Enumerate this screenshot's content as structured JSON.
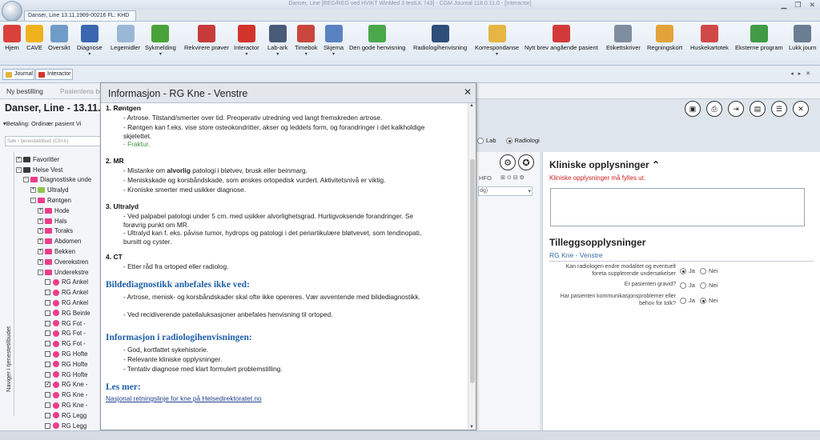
{
  "window": {
    "title": "Danser, Line [REG/REG ved HVIKT WinMed 3 testLK 743] - CGM Journal 118.0.11.0 - [Interactor]",
    "app_tab": "Danser, Line 13.11.1969-00216 FL: KHD"
  },
  "ribbon": {
    "buttons": [
      {
        "label": "Hjem",
        "icon": "home-icon",
        "color": "#d9413c"
      },
      {
        "label": "CAVE",
        "icon": "warning-icon",
        "color": "#f0b21c"
      },
      {
        "label": "Oversikt",
        "icon": "overview-icon",
        "color": "#6f9bc8"
      },
      {
        "label": "Diagnose",
        "icon": "diagnose-icon",
        "color": "#3a67b0"
      },
      {
        "label": "Legemidler",
        "icon": "pill-icon",
        "color": "#9bb7d6"
      },
      {
        "label": "Sykmelding",
        "icon": "wheelchair-icon",
        "color": "#4aa23a"
      },
      {
        "label": "Rekvirere prøver",
        "icon": "test-tube-icon",
        "color": "#c73a3a"
      },
      {
        "label": "Interactor",
        "icon": "interactor-icon",
        "color": "#d2342b"
      },
      {
        "label": "Lab-ark",
        "icon": "lab-sheet-icon",
        "color": "#4a5b7a"
      },
      {
        "label": "Timebok",
        "icon": "calendar-icon",
        "color": "#c9463c"
      },
      {
        "label": "Skjema",
        "icon": "form-icon",
        "color": "#5b82c0"
      },
      {
        "label": "Den gode henvisning",
        "icon": "referral-icon",
        "color": "#49a84a"
      },
      {
        "label": "Radiologihenvisning",
        "icon": "radiology-icon",
        "color": "#2e4f7a"
      },
      {
        "label": "Korrespondanse",
        "icon": "envelope-icon",
        "color": "#e6b543"
      },
      {
        "label": "Nytt brev angående pasient",
        "icon": "new-letter-icon",
        "color": "#d23a3a"
      },
      {
        "label": "Etikettskriver",
        "icon": "label-printer-icon",
        "color": "#7f8da0"
      },
      {
        "label": "Regningskort",
        "icon": "invoice-icon",
        "color": "#e2a33a"
      },
      {
        "label": "Huskekartotek",
        "icon": "checklist-icon",
        "color": "#d14848"
      },
      {
        "label": "Eksterne program",
        "icon": "gear-puzzle-icon",
        "color": "#3f9b45"
      },
      {
        "label": "Lukk journ",
        "icon": "close-journal-icon",
        "color": "#6a7d92"
      }
    ],
    "dropdown_marker": "▾"
  },
  "strip": {
    "tabs": [
      {
        "label": "Journal",
        "color": "#e3b53a"
      },
      {
        "label": "Interactor",
        "color": "#d2342b"
      }
    ],
    "nav_arrows": "◂ ▸ ✕"
  },
  "subtabs": {
    "new_order": "Ny bestilling",
    "patient_orders": "Pasientens be"
  },
  "patient": {
    "name": "Danser, Line - 13.11.1969"
  },
  "payment": "Betaling: Ordinær pasient Vi",
  "search": {
    "placeholder": "Søk i tjenestetilbud (Ctrl-k)"
  },
  "navigator_label": "Naviger i tjenestetilbudet",
  "tree": [
    {
      "level": 0,
      "kind": "folder",
      "toggle": "+",
      "label": "Favoritter",
      "color": "#3a3a3a"
    },
    {
      "level": 0,
      "kind": "folder",
      "toggle": "−",
      "label": "Helse Vest",
      "color": "#3a3a3a"
    },
    {
      "level": 1,
      "kind": "folder",
      "toggle": "−",
      "label": "Diagnostiske unde",
      "color": "#ec3d8b"
    },
    {
      "level": 2,
      "kind": "folder",
      "toggle": "+",
      "label": "Ultralyd",
      "color": "#8bc34a"
    },
    {
      "level": 2,
      "kind": "folder",
      "toggle": "−",
      "label": "Røntgen",
      "color": "#ec3d8b"
    },
    {
      "level": 3,
      "kind": "folder",
      "toggle": "+",
      "label": "Hode",
      "color": "#ec3d8b"
    },
    {
      "level": 3,
      "kind": "folder",
      "toggle": "+",
      "label": "Hals",
      "color": "#ec3d8b"
    },
    {
      "level": 3,
      "kind": "folder",
      "toggle": "+",
      "label": "Toraks",
      "color": "#ec3d8b"
    },
    {
      "level": 3,
      "kind": "folder",
      "toggle": "+",
      "label": "Abdomen",
      "color": "#ec3d8b"
    },
    {
      "level": 3,
      "kind": "folder",
      "toggle": "+",
      "label": "Bekken",
      "color": "#ec3d8b"
    },
    {
      "level": 3,
      "kind": "folder",
      "toggle": "+",
      "label": "Overekstren",
      "color": "#ec3d8b"
    },
    {
      "level": 3,
      "kind": "folder",
      "toggle": "−",
      "label": "Underekstre",
      "color": "#ec3d8b"
    },
    {
      "level": 4,
      "kind": "item",
      "checked": false,
      "label": "RG Ankel"
    },
    {
      "level": 4,
      "kind": "item",
      "checked": false,
      "label": "RG Ankel"
    },
    {
      "level": 4,
      "kind": "item",
      "checked": false,
      "label": "RG Ankel"
    },
    {
      "level": 4,
      "kind": "item",
      "checked": false,
      "label": "RG Beinle"
    },
    {
      "level": 4,
      "kind": "item",
      "checked": false,
      "label": "RG Fot -"
    },
    {
      "level": 4,
      "kind": "item",
      "checked": false,
      "label": "RG Fot -"
    },
    {
      "level": 4,
      "kind": "item",
      "checked": false,
      "label": "RG Fot -"
    },
    {
      "level": 4,
      "kind": "item",
      "checked": false,
      "label": "RG Hofte"
    },
    {
      "level": 4,
      "kind": "item",
      "checked": false,
      "label": "RG Hofte"
    },
    {
      "level": 4,
      "kind": "item",
      "checked": false,
      "label": "RG Hofte"
    },
    {
      "level": 4,
      "kind": "item",
      "checked": true,
      "label": "RG Kne -"
    },
    {
      "level": 4,
      "kind": "item",
      "checked": false,
      "label": "RG Kne -"
    },
    {
      "level": 4,
      "kind": "item",
      "checked": false,
      "label": "RG Kne -"
    },
    {
      "level": 4,
      "kind": "item",
      "checked": false,
      "label": "RG Legg"
    },
    {
      "level": 4,
      "kind": "item",
      "checked": false,
      "label": "RG Legg"
    }
  ],
  "modality": {
    "lab": "Lab",
    "radiology": "Radiologi",
    "selected": "Radiologi"
  },
  "mid": {
    "hfo": "HFO",
    "icons": "⊞⊙⊟⚙",
    "select_value": "dg)"
  },
  "clinical": {
    "heading": "Kliniske opplysninger ⌃",
    "error": "Kliniske opplysninger må fylles ut.",
    "value": ""
  },
  "additional": {
    "heading": "Tilleggsopplysninger",
    "subheading": "RG Kne - Venstre",
    "yes": "Ja",
    "no": "Nei",
    "questions": [
      {
        "text": "Kan radiologen endre modalitet og eventuelt foreta supplerende undersøkelser",
        "answer": "Ja"
      },
      {
        "text": "Er pasienten gravid?",
        "answer": ""
      },
      {
        "text": "Har pasienten kommunikasjonsproblemer eller behov for tolk?",
        "answer": "Nei"
      }
    ]
  },
  "modal": {
    "title": "Informasjon - RG Kne - Venstre",
    "sections": [
      {
        "title": "1. Røntgen",
        "items": [
          "- Artrose. Tilstand/smerter over tid. Preoperativ utredning ved langt fremskreden artrose.",
          "- Røntgen kan f.eks. vise store osteokondritter, akser og leddets form, og forandringer i det kalkholdige skjelettet.",
          "- Fraktur."
        ]
      },
      {
        "title": "2. MR",
        "items": [
          "- Mistanke om alvorlig patologi i bløtvev, brusk eller beinmarg.",
          "- Meniskskade og korsbåndskade, som ønskes ortopedisk vurdert. Aktivitetsnivå er viktig.",
          "- Kroniske smerter med usikker diagnose."
        ]
      },
      {
        "title": "3. Ultralyd",
        "items": [
          "- Ved palpabel patologi under 5 cm. med usikker alvorlighetsgrad. Hurtigvoksende forandringer. Se forøvrig punkt om MR.",
          "- Ultralyd kan f. eks. påvise tumor, hydrops og patologi i det periartikulære bløtvevet, som tendinopati, bursitt og cyster."
        ]
      },
      {
        "title": "4. CT",
        "items": [
          "- Etter råd fra ortoped eller radiolog."
        ]
      }
    ],
    "not_recommended_heading": "Bildediagnostikk anbefales ikke ved:",
    "not_recommended": [
      "- Artrose, menisk- og korsbåndskader skal ofte ikke opereres. Vær avventende med bildediagnostikk.",
      "- Ved recidiverende patellaluksasjoner anbefales henvisning til ortoped."
    ],
    "referral_heading": "Informasjon i radiologihenvisningen:",
    "referral": [
      "- God, kortfattet sykehistorie.",
      "- Relevante kliniske opplysninger.",
      "- Tentativ diagnose med klart formulert problemstilling."
    ],
    "more_heading": "Les mer:",
    "link": "Nasjonal retningslinje for kne på Helsedirektoratet.no"
  }
}
